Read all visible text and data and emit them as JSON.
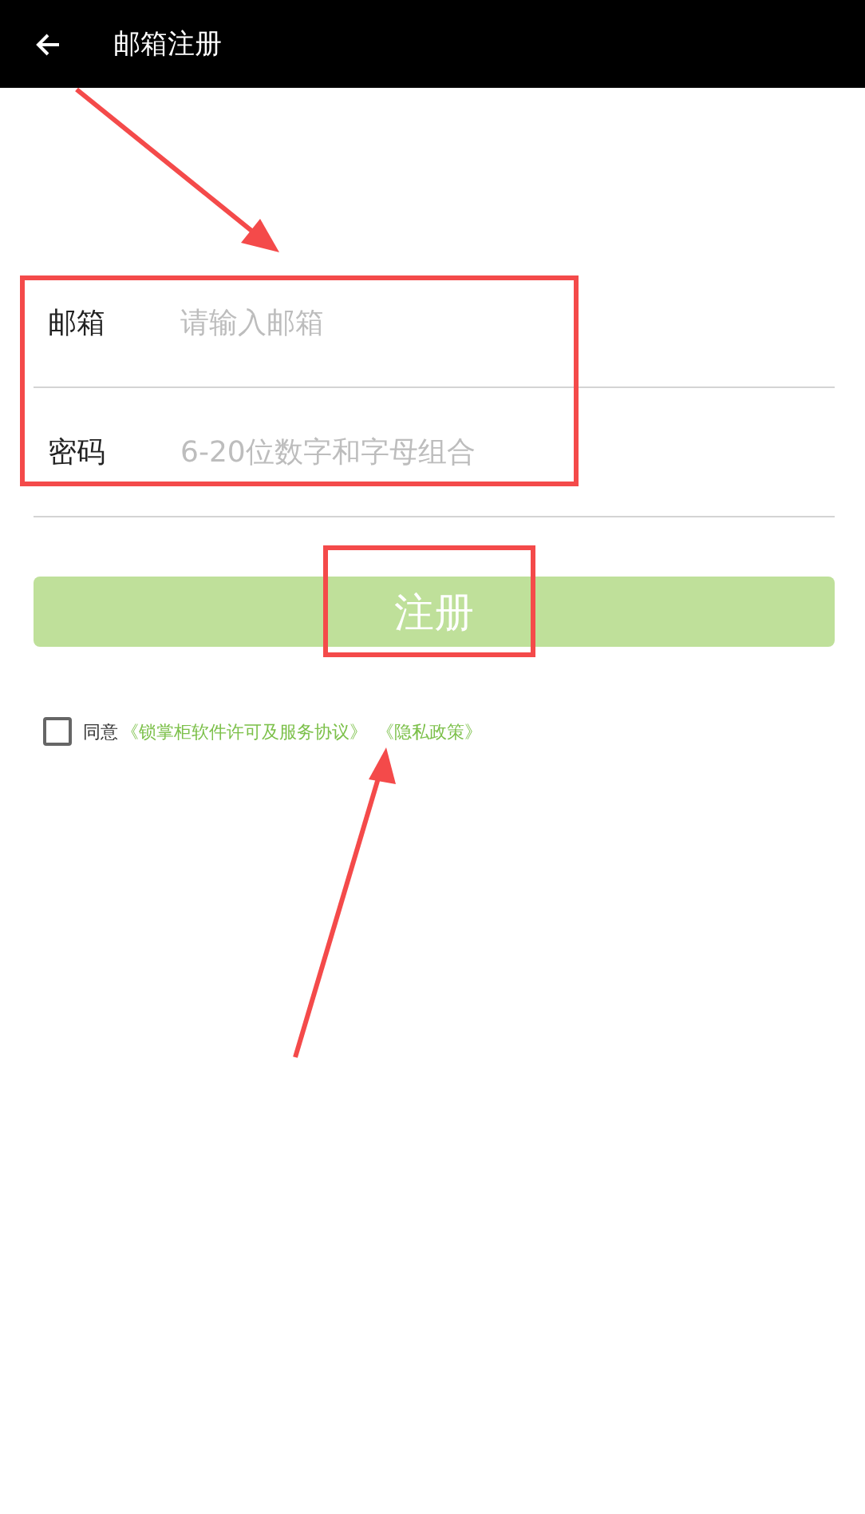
{
  "header": {
    "title": "邮箱注册"
  },
  "fields": [
    {
      "label": "邮箱",
      "placeholder": "请输入邮箱"
    },
    {
      "label": "密码",
      "placeholder": "6-20位数字和字母组合"
    }
  ],
  "register_button": {
    "label": "注册",
    "disabled": true
  },
  "agreement": {
    "checked": false,
    "text": "同意",
    "links": [
      "《锁掌柜软件许可及服务协议》",
      "《隐私政策》"
    ]
  }
}
